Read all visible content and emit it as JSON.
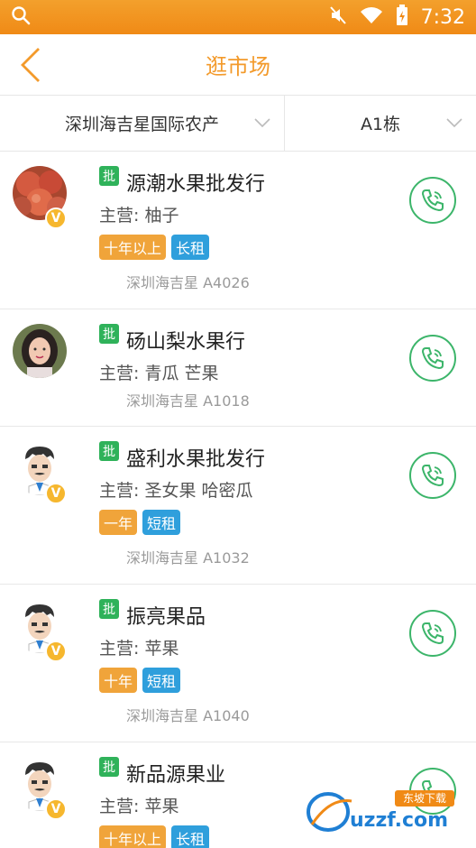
{
  "status_bar": {
    "time": "7:32"
  },
  "header": {
    "title": "逛市场"
  },
  "filters": [
    {
      "label": "深圳海吉星国际农产"
    },
    {
      "label": "A1栋"
    }
  ],
  "colors": {
    "accent": "#f39a2b",
    "green": "#3cb56a",
    "tag_age": "#f0a43a",
    "tag_rent": "#2f9fdc"
  },
  "list": [
    {
      "badge": "批",
      "name": "源潮水果批发行",
      "main": "主营: 柚子",
      "tags": [
        "十年以上",
        "长租"
      ],
      "address": "深圳海吉星 A4026",
      "avatar": "fruit-photo"
    },
    {
      "badge": "批",
      "name": "砀山梨水果行",
      "main": "主营: 青瓜 芒果",
      "tags": [],
      "address": "深圳海吉星 A1018",
      "avatar": "person-photo"
    },
    {
      "badge": "批",
      "name": "盛利水果批发行",
      "main": "主营: 圣女果 哈密瓜",
      "tags": [
        "一年",
        "短租"
      ],
      "address": "深圳海吉星 A1032",
      "avatar": "cartoon-man"
    },
    {
      "badge": "批",
      "name": "振亮果品",
      "main": "主营: 苹果",
      "tags": [
        "十年",
        "短租"
      ],
      "address": "深圳海吉星 A1040",
      "avatar": "cartoon-man"
    },
    {
      "badge": "批",
      "name": "新品源果业",
      "main": "主营: 苹果",
      "tags": [
        "十年以上",
        "长租"
      ],
      "address": "",
      "avatar": "cartoon-man"
    }
  ],
  "vip_badge": "V",
  "watermark": {
    "brand": "uzzf.com",
    "tag": "东坡下载"
  }
}
